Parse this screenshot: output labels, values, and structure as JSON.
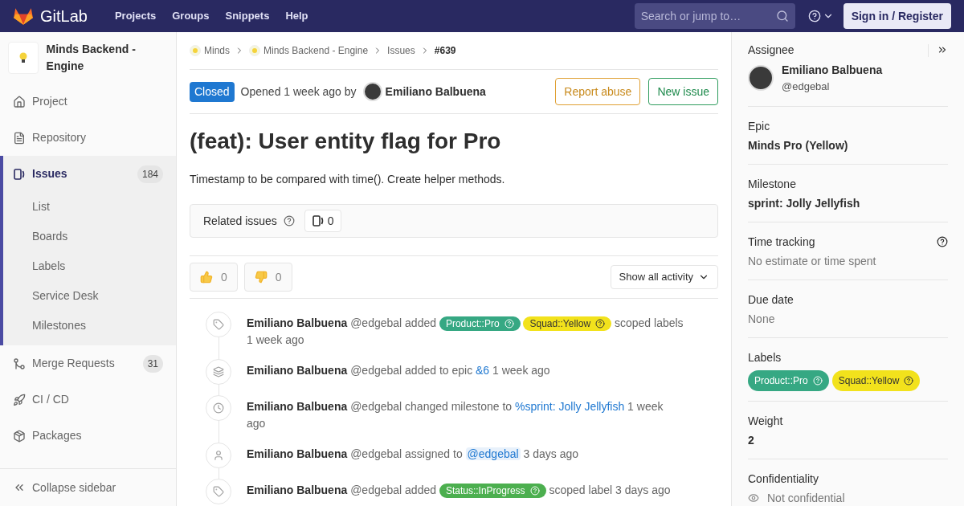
{
  "header": {
    "brand": "GitLab",
    "nav": [
      "Projects",
      "Groups",
      "Snippets",
      "Help"
    ],
    "search": {
      "placeholder": "Search or jump to…"
    },
    "sign_in": "Sign in / Register"
  },
  "sidebar": {
    "project": "Minds Backend - Engine",
    "items": [
      {
        "kind": "home",
        "label": "Project",
        "selected": false
      },
      {
        "kind": "file",
        "label": "Repository",
        "selected": false
      },
      {
        "kind": "issues",
        "label": "Issues",
        "count": "184",
        "selected": true,
        "children": [
          {
            "label": "List"
          },
          {
            "label": "Boards"
          },
          {
            "label": "Labels"
          },
          {
            "label": "Service Desk"
          },
          {
            "label": "Milestones"
          }
        ]
      },
      {
        "kind": "merge",
        "label": "Merge Requests",
        "count": "31",
        "selected": false
      },
      {
        "kind": "rocket",
        "label": "CI / CD",
        "selected": false
      },
      {
        "kind": "package",
        "label": "Packages",
        "selected": false
      }
    ],
    "collapse": "Collapse sidebar"
  },
  "breadcrumbs": [
    {
      "label": "Minds",
      "kind": "project"
    },
    {
      "label": "Minds Backend - Engine",
      "kind": "project"
    },
    {
      "label": "Issues",
      "kind": "link"
    },
    {
      "label": "#639",
      "kind": "current"
    }
  ],
  "issue": {
    "status": "Closed",
    "opened": "Opened 1 week ago by",
    "author": "Emiliano Balbuena",
    "buttons": [
      {
        "label": "Report abuse",
        "kind": "warning"
      },
      {
        "label": "New issue",
        "kind": "success"
      }
    ],
    "title": "(feat): User entity flag for Pro",
    "description": "Timestamp to be compared with time(). Create helper methods.",
    "related": {
      "label": "Related issues",
      "count": "0"
    },
    "reactions": [
      {
        "kind": "up",
        "count": "0"
      },
      {
        "kind": "down",
        "count": "0"
      }
    ],
    "filter": "Show all activity"
  },
  "activity": [
    {
      "kind": "tag",
      "parts": [
        {
          "kind": "author",
          "text": "Emiliano Balbuena"
        },
        {
          "kind": "text",
          "text": "@edgebal added"
        },
        {
          "kind": "label",
          "text": "Product::Pro",
          "color": "#36a883"
        },
        {
          "kind": "label",
          "text": "Squad::Yellow",
          "color": "#f2e21c"
        },
        {
          "kind": "text",
          "text": "scoped labels"
        },
        {
          "kind": "text",
          "text": "1 week ago"
        }
      ]
    },
    {
      "kind": "epic",
      "parts": [
        {
          "kind": "author",
          "text": "Emiliano Balbuena"
        },
        {
          "kind": "text",
          "text": "@edgebal added to epic"
        },
        {
          "kind": "link",
          "text": "&6"
        },
        {
          "kind": "text",
          "text": "1 week ago"
        }
      ]
    },
    {
      "kind": "clock",
      "parts": [
        {
          "kind": "author",
          "text": "Emiliano Balbuena"
        },
        {
          "kind": "text",
          "text": "@edgebal changed milestone to"
        },
        {
          "kind": "link",
          "text": "%sprint: Jolly Jellyfish"
        },
        {
          "kind": "text",
          "text": "1 week ago"
        }
      ]
    },
    {
      "kind": "user",
      "parts": [
        {
          "kind": "author",
          "text": "Emiliano Balbuena"
        },
        {
          "kind": "text",
          "text": "@edgebal assigned to"
        },
        {
          "kind": "mention",
          "text": "@edgebal"
        },
        {
          "kind": "text",
          "text": "3 days ago"
        }
      ]
    },
    {
      "kind": "tag",
      "parts": [
        {
          "kind": "author",
          "text": "Emiliano Balbuena"
        },
        {
          "kind": "text",
          "text": "@edgebal added"
        },
        {
          "kind": "label",
          "text": "Status::InProgress",
          "color": "#4caf4f"
        },
        {
          "kind": "text",
          "text": "scoped label 3 days ago"
        }
      ]
    }
  ],
  "right_sidebar": {
    "assignee": {
      "heading": "Assignee",
      "name": "Emiliano Balbuena",
      "username": "@edgebal"
    },
    "sections": [
      {
        "kind": "bold",
        "heading": "Epic",
        "value": "Minds Pro (Yellow)"
      },
      {
        "kind": "bold",
        "heading": "Milestone",
        "value": "sprint: Jolly Jellyfish"
      },
      {
        "kind": "muted",
        "heading": "Time tracking",
        "value": "No estimate or time spent",
        "help": true
      },
      {
        "kind": "muted",
        "heading": "Due date",
        "value": "None"
      },
      {
        "kind": "labels",
        "heading": "Labels",
        "labels": [
          {
            "text": "Product::Pro",
            "color": "#36a883"
          },
          {
            "text": "Squad::Yellow",
            "color": "#f2e21c"
          }
        ]
      },
      {
        "kind": "bold",
        "heading": "Weight",
        "value": "2"
      },
      {
        "kind": "eye",
        "heading": "Confidentiality",
        "value": "Not confidential"
      }
    ]
  }
}
